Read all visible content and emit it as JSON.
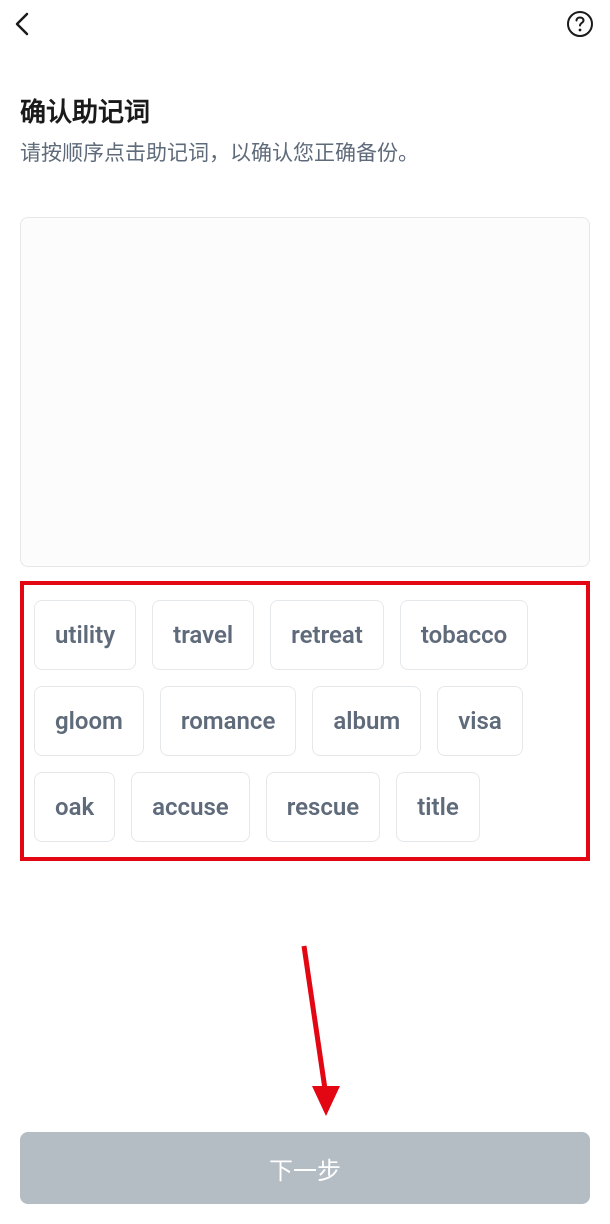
{
  "header": {
    "back_icon": "back-chevron",
    "help_icon": "help-circle"
  },
  "title": "确认助记词",
  "subtitle": "请按顺序点击助记词，以确认您正确备份。",
  "words": [
    "utility",
    "travel",
    "retreat",
    "tobacco",
    "gloom",
    "romance",
    "album",
    "visa",
    "oak",
    "accuse",
    "rescue",
    "title"
  ],
  "next_label": "下一步",
  "colors": {
    "annotation_red": "#e30613",
    "text_secondary": "#5f6b7a",
    "button_disabled": "#b4bcc4"
  }
}
